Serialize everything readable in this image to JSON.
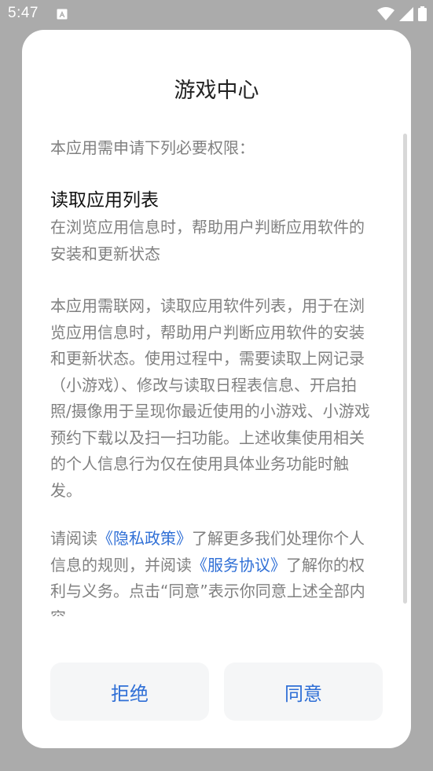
{
  "status_bar": {
    "time": "5:47",
    "icons": [
      "notification-a-icon",
      "wifi-icon",
      "signal-icon",
      "battery-icon"
    ]
  },
  "dialog": {
    "title": "游戏中心",
    "intro": "本应用需申请下列必要权限：",
    "permission": {
      "title": "读取应用列表",
      "description": "在浏览应用信息时，帮助用户判断应用软件的安装和更新状态"
    },
    "explanation": "本应用需联网，读取应用软件列表，用于在浏览应用信息时，帮助用户判断应用软件的安装和更新状态。使用过程中，需要读取上网记录（小游戏）、修改与读取日程表信息、开启拍照/摄像用于呈现你最近使用的小游戏、小游戏预约下载以及扫一扫功能。上述收集使用相关的个人信息行为仅在使用具体业务功能时触发。",
    "policy": {
      "prefix": "请阅读",
      "privacy_link": "《隐私政策》",
      "middle": "了解更多我们处理你个人信息的规则，并阅读",
      "service_link": "《服务协议》",
      "suffix": "了解你的权利与义务。点击“同意”表示你同意上述全部内容"
    },
    "buttons": {
      "reject": "拒绝",
      "agree": "同意"
    }
  },
  "colors": {
    "accent": "#2f6fd6",
    "backdrop": "#ababab",
    "secondary_text": "#808080"
  }
}
